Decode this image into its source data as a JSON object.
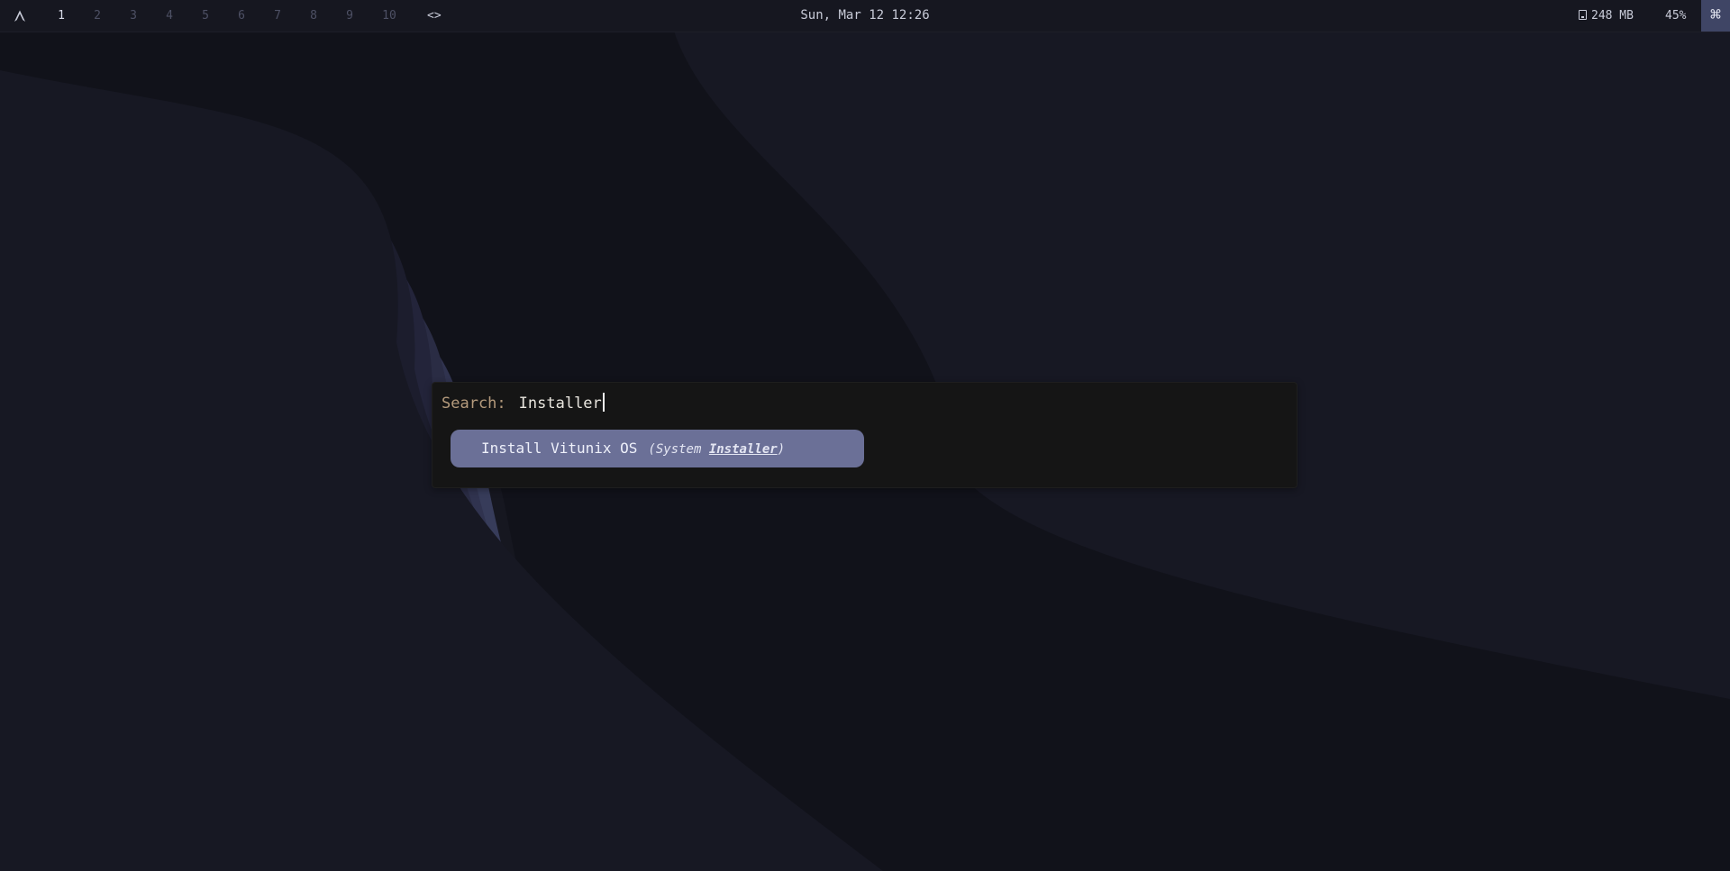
{
  "colors": {
    "bar_bg": "#161720",
    "workspace_active": "#d8dbe8",
    "workspace_inactive": "#4d5064",
    "command_button_bg": "#3f4565",
    "launcher_bg": "#151515",
    "search_label": "#b49a7c",
    "result_highlight": "#6b7097",
    "wallpaper_dark": "#11121a",
    "wallpaper_light": "#3f4566"
  },
  "topbar": {
    "logo_icon": "arch-logo-icon",
    "workspaces": [
      {
        "label": "1",
        "active": true
      },
      {
        "label": "2",
        "active": false
      },
      {
        "label": "3",
        "active": false
      },
      {
        "label": "4",
        "active": false
      },
      {
        "label": "5",
        "active": false
      },
      {
        "label": "6",
        "active": false
      },
      {
        "label": "7",
        "active": false
      },
      {
        "label": "8",
        "active": false
      },
      {
        "label": "9",
        "active": false
      },
      {
        "label": "10",
        "active": false
      }
    ],
    "layout_indicator": "<>",
    "clock": "Sun, Mar 12 12:26",
    "memory": "248 MB",
    "memory_icon": "disk-icon",
    "cpu": "45%",
    "command_icon": "command-icon",
    "command_glyph": "⌘"
  },
  "launcher": {
    "search_label": "Search:",
    "search_value": "Installer",
    "results": [
      {
        "title": "Install Vitunix OS",
        "subtitle_open": "(System ",
        "subtitle_match": "Installer",
        "subtitle_close": ")",
        "selected": true
      }
    ]
  }
}
